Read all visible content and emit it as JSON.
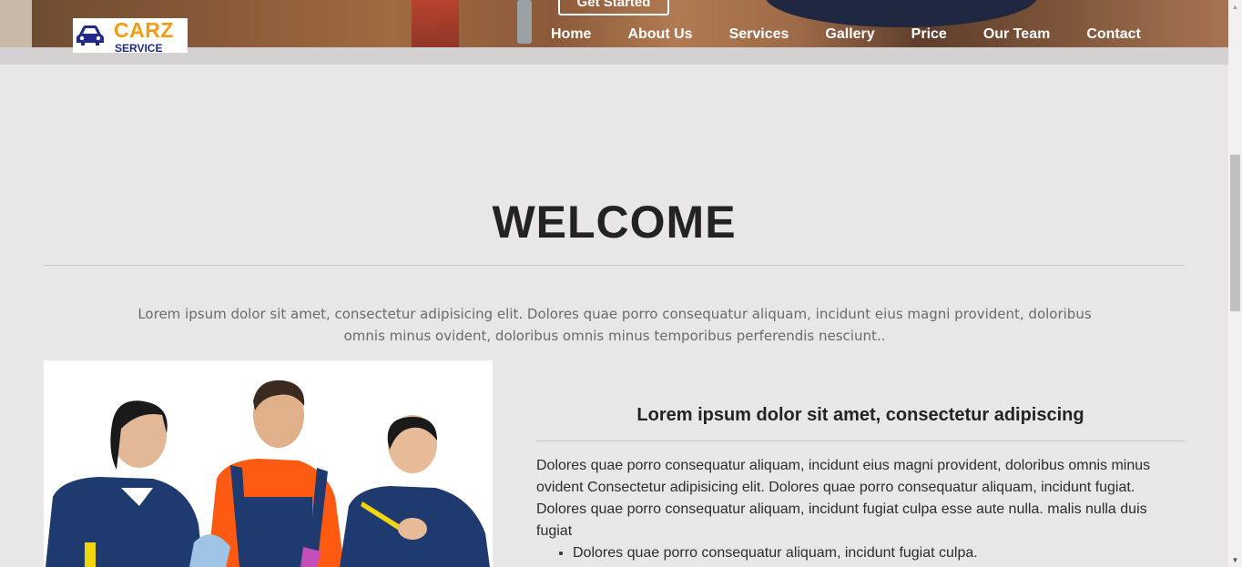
{
  "hero": {
    "cta_label": "Get Started"
  },
  "logo": {
    "brand": "CARZ",
    "sub": "SERVICE",
    "icon": "car-icon"
  },
  "nav": {
    "items": [
      "Home",
      "About Us",
      "Services",
      "Gallery",
      "Price",
      "Our Team",
      "Contact"
    ]
  },
  "welcome": {
    "title": "WELCOME",
    "intro": "Lorem ipsum dolor sit amet, consectetur adipisicing elit. Dolores quae porro consequatur aliquam, incidunt eius magni provident, doloribus omnis minus ovident, doloribus omnis minus temporibus perferendis nesciunt.."
  },
  "about": {
    "heading": "Lorem ipsum dolor sit amet, consectetur adipiscing",
    "paragraph": "Dolores quae porro consequatur aliquam, incidunt eius magni provident, doloribus omnis minus ovident Consectetur adipisicing elit. Dolores quae porro consequatur aliquam, incidunt fugiat. Dolores quae porro consequatur aliquam, incidunt fugiat culpa esse aute nulla. malis nulla duis fugiat",
    "bullets": [
      "Dolores quae porro consequatur aliquam, incidunt fugiat culpa."
    ]
  },
  "colors": {
    "logo_brand": "#f39c12",
    "logo_sub": "#1f2a8a",
    "background": "#e8e6e7"
  }
}
